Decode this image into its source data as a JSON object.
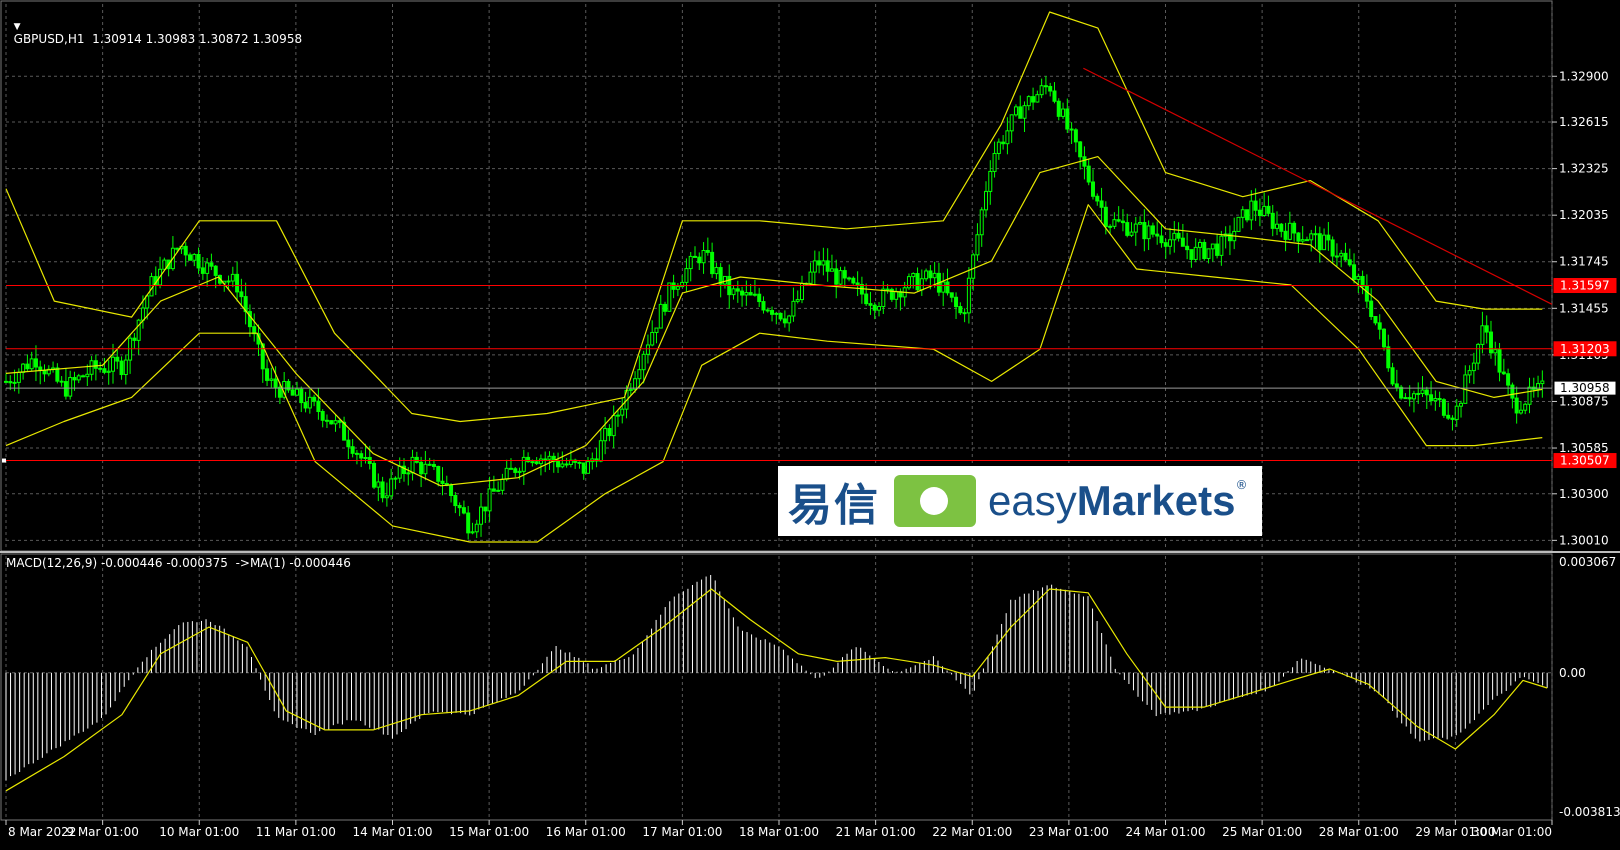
{
  "header": {
    "symbol_line": "GBPUSD,H1  1.30914 1.30983 1.30872 1.30958",
    "macd_line": "MACD(12,26,9) -0.000446 -0.000375  ->MA(1) -0.000446"
  },
  "watermark": {
    "chinese": "易信",
    "english_light": "easy",
    "english_bold": "Markets",
    "registered": "®"
  },
  "colors": {
    "background": "#000000",
    "grid": "#5a5a5a",
    "candle": "#00ff00",
    "bollinger": "#e8e800",
    "level_line": "#ff0000",
    "trend_line": "#d40000",
    "macd_hist": "#ffffff",
    "macd_signal": "#e8e800"
  },
  "chart_data": [
    {
      "type": "line",
      "title": "GBPUSD,H1",
      "x": [
        "8 Mar 2022",
        "9 Mar 01:00",
        "10 Mar 01:00",
        "11 Mar 01:00",
        "14 Mar 01:00",
        "15 Mar 01:00",
        "16 Mar 01:00",
        "17 Mar 01:00",
        "18 Mar 01:00",
        "21 Mar 01:00",
        "22 Mar 01:00",
        "23 Mar 01:00",
        "24 Mar 01:00",
        "25 Mar 01:00",
        "28 Mar 01:00",
        "29 Mar 01:00",
        "30 Mar 01:00"
      ],
      "y_ticks": [
        "1.32900",
        "1.32615",
        "1.32325",
        "1.32035",
        "1.31745",
        "1.31455",
        "1.31165",
        "1.30875",
        "1.30585",
        "1.30300",
        "1.30010"
      ],
      "ylim": [
        1.2995,
        1.3335
      ],
      "series": [],
      "price_path": [
        [
          0,
          1.31
        ],
        [
          0.3,
          1.3115
        ],
        [
          0.6,
          1.3095
        ],
        [
          0.9,
          1.3108
        ],
        [
          1.2,
          1.311
        ],
        [
          1.5,
          1.316
        ],
        [
          1.8,
          1.3185
        ],
        [
          2.1,
          1.317
        ],
        [
          2.4,
          1.316
        ],
        [
          2.7,
          1.31
        ],
        [
          3.0,
          1.309
        ],
        [
          3.3,
          1.308
        ],
        [
          3.6,
          1.306
        ],
        [
          3.9,
          1.303
        ],
        [
          4.2,
          1.305
        ],
        [
          4.5,
          1.304
        ],
        [
          4.8,
          1.301
        ],
        [
          5.1,
          1.3035
        ],
        [
          5.4,
          1.3055
        ],
        [
          5.7,
          1.305
        ],
        [
          6.0,
          1.3045
        ],
        [
          6.3,
          1.3075
        ],
        [
          6.6,
          1.312
        ],
        [
          6.9,
          1.316
        ],
        [
          7.2,
          1.318
        ],
        [
          7.5,
          1.3155
        ],
        [
          7.8,
          1.315
        ],
        [
          8.1,
          1.314
        ],
        [
          8.4,
          1.3175
        ],
        [
          8.7,
          1.316
        ],
        [
          9.0,
          1.315
        ],
        [
          9.3,
          1.316
        ],
        [
          9.6,
          1.3165
        ],
        [
          9.9,
          1.314
        ],
        [
          10.2,
          1.324
        ],
        [
          10.5,
          1.327
        ],
        [
          10.8,
          1.3285
        ],
        [
          11.1,
          1.324
        ],
        [
          11.4,
          1.32
        ],
        [
          11.7,
          1.3195
        ],
        [
          12.0,
          1.319
        ],
        [
          12.3,
          1.318
        ],
        [
          12.6,
          1.3185
        ],
        [
          12.9,
          1.321
        ],
        [
          13.2,
          1.3195
        ],
        [
          13.5,
          1.319
        ],
        [
          13.8,
          1.318
        ],
        [
          14.1,
          1.315
        ],
        [
          14.4,
          1.3095
        ],
        [
          14.7,
          1.309
        ],
        [
          15.0,
          1.308
        ],
        [
          15.3,
          1.3135
        ],
        [
          15.6,
          1.3085
        ],
        [
          15.9,
          1.3095
        ]
      ],
      "bollinger_mid": [
        [
          0,
          1.3105
        ],
        [
          1,
          1.311
        ],
        [
          1.6,
          1.315
        ],
        [
          2.2,
          1.3165
        ],
        [
          3.0,
          1.3105
        ],
        [
          3.8,
          1.3055
        ],
        [
          4.5,
          1.3035
        ],
        [
          5.3,
          1.304
        ],
        [
          6.0,
          1.306
        ],
        [
          6.6,
          1.31
        ],
        [
          7.0,
          1.3155
        ],
        [
          7.6,
          1.3165
        ],
        [
          8.4,
          1.316
        ],
        [
          9.4,
          1.3155
        ],
        [
          10.2,
          1.3175
        ],
        [
          10.7,
          1.323
        ],
        [
          11.3,
          1.324
        ],
        [
          12.0,
          1.3195
        ],
        [
          12.8,
          1.319
        ],
        [
          13.5,
          1.3185
        ],
        [
          14.2,
          1.315
        ],
        [
          14.8,
          1.31
        ],
        [
          15.4,
          1.309
        ],
        [
          15.9,
          1.3095
        ]
      ],
      "bollinger_upper": [
        [
          0,
          1.322
        ],
        [
          0.5,
          1.315
        ],
        [
          1.3,
          1.314
        ],
        [
          2.0,
          1.32
        ],
        [
          2.8,
          1.32
        ],
        [
          3.4,
          1.313
        ],
        [
          4.2,
          1.308
        ],
        [
          4.7,
          1.3075
        ],
        [
          5.6,
          1.308
        ],
        [
          6.4,
          1.309
        ],
        [
          7.0,
          1.32
        ],
        [
          7.8,
          1.32
        ],
        [
          8.7,
          1.3195
        ],
        [
          9.7,
          1.32
        ],
        [
          10.3,
          1.326
        ],
        [
          10.8,
          1.333
        ],
        [
          11.3,
          1.332
        ],
        [
          12.0,
          1.323
        ],
        [
          12.8,
          1.3215
        ],
        [
          13.5,
          1.3225
        ],
        [
          14.2,
          1.32
        ],
        [
          14.8,
          1.315
        ],
        [
          15.3,
          1.3145
        ],
        [
          15.9,
          1.3145
        ]
      ],
      "bollinger_lower": [
        [
          0,
          1.306
        ],
        [
          0.6,
          1.3075
        ],
        [
          1.3,
          1.309
        ],
        [
          2.0,
          1.313
        ],
        [
          2.6,
          1.313
        ],
        [
          3.2,
          1.305
        ],
        [
          4.0,
          1.301
        ],
        [
          4.8,
          1.3
        ],
        [
          5.5,
          1.3
        ],
        [
          6.2,
          1.303
        ],
        [
          6.8,
          1.305
        ],
        [
          7.2,
          1.311
        ],
        [
          7.8,
          1.313
        ],
        [
          8.5,
          1.3125
        ],
        [
          9.6,
          1.312
        ],
        [
          10.2,
          1.31
        ],
        [
          10.7,
          1.312
        ],
        [
          11.2,
          1.321
        ],
        [
          11.7,
          1.317
        ],
        [
          12.5,
          1.3165
        ],
        [
          13.3,
          1.316
        ],
        [
          14.0,
          1.312
        ],
        [
          14.7,
          1.306
        ],
        [
          15.2,
          1.306
        ],
        [
          15.9,
          1.3065
        ]
      ],
      "horizontal_levels": [
        {
          "value": 1.31597,
          "label": "1.31597",
          "style": "red"
        },
        {
          "value": 1.31203,
          "label": "1.31203",
          "style": "red"
        },
        {
          "value": 1.30958,
          "label": "1.30958",
          "style": "current"
        },
        {
          "value": 1.30507,
          "label": "1.30507",
          "style": "red"
        }
      ],
      "trend_line": [
        [
          11.15,
          1.3295
        ],
        [
          16.0,
          1.3148
        ]
      ]
    },
    {
      "type": "bar",
      "title": "MACD(12,26,9)",
      "y_ticks": [
        "0.003067",
        "0.00",
        "-0.003813"
      ],
      "ylim": [
        -0.003813,
        0.003067
      ],
      "macd_path": [
        [
          0,
          -0.0028
        ],
        [
          0.5,
          -0.002
        ],
        [
          1.0,
          -0.0012
        ],
        [
          1.4,
          0.0003
        ],
        [
          1.8,
          0.0013
        ],
        [
          2.1,
          0.0014
        ],
        [
          2.5,
          0.0007
        ],
        [
          2.8,
          -0.0012
        ],
        [
          3.2,
          -0.0016
        ],
        [
          3.6,
          -0.0012
        ],
        [
          4.0,
          -0.0017
        ],
        [
          4.4,
          -0.001
        ],
        [
          4.8,
          -0.0011
        ],
        [
          5.3,
          -0.0005
        ],
        [
          5.7,
          0.0007
        ],
        [
          6.1,
          0.0001
        ],
        [
          6.5,
          0.0005
        ],
        [
          6.9,
          0.002
        ],
        [
          7.3,
          0.0026
        ],
        [
          7.6,
          0.0011
        ],
        [
          8.0,
          0.0007
        ],
        [
          8.4,
          -0.0002
        ],
        [
          8.8,
          0.0007
        ],
        [
          9.2,
          0.0
        ],
        [
          9.6,
          0.0004
        ],
        [
          10.0,
          -0.0006
        ],
        [
          10.4,
          0.0019
        ],
        [
          10.8,
          0.0023
        ],
        [
          11.2,
          0.002
        ],
        [
          11.5,
          0.0
        ],
        [
          11.9,
          -0.0011
        ],
        [
          12.3,
          -0.001
        ],
        [
          12.7,
          -0.0007
        ],
        [
          13.1,
          -0.0004
        ],
        [
          13.4,
          0.0004
        ],
        [
          13.8,
          0.0
        ],
        [
          14.2,
          -0.0005
        ],
        [
          14.6,
          -0.0018
        ],
        [
          15.0,
          -0.0017
        ],
        [
          15.4,
          -0.0007
        ],
        [
          15.7,
          -0.0001
        ],
        [
          15.95,
          -0.0004
        ]
      ],
      "signal_path": [
        [
          0,
          -0.0031
        ],
        [
          0.6,
          -0.0022
        ],
        [
          1.2,
          -0.0011
        ],
        [
          1.6,
          0.0005
        ],
        [
          2.1,
          0.0012
        ],
        [
          2.5,
          0.0008
        ],
        [
          2.9,
          -0.001
        ],
        [
          3.3,
          -0.0015
        ],
        [
          3.8,
          -0.0015
        ],
        [
          4.3,
          -0.0011
        ],
        [
          4.8,
          -0.001
        ],
        [
          5.3,
          -0.0006
        ],
        [
          5.8,
          0.0003
        ],
        [
          6.3,
          0.0003
        ],
        [
          6.8,
          0.0012
        ],
        [
          7.3,
          0.0022
        ],
        [
          7.7,
          0.0014
        ],
        [
          8.2,
          0.0005
        ],
        [
          8.6,
          0.0003
        ],
        [
          9.1,
          0.0004
        ],
        [
          9.6,
          0.0002
        ],
        [
          10.0,
          -0.0001
        ],
        [
          10.4,
          0.0012
        ],
        [
          10.8,
          0.0022
        ],
        [
          11.2,
          0.0021
        ],
        [
          11.6,
          0.0005
        ],
        [
          12.0,
          -0.0009
        ],
        [
          12.4,
          -0.0009
        ],
        [
          12.8,
          -0.0006
        ],
        [
          13.3,
          -0.0002
        ],
        [
          13.7,
          0.0001
        ],
        [
          14.1,
          -0.0003
        ],
        [
          14.6,
          -0.0014
        ],
        [
          15.0,
          -0.002
        ],
        [
          15.4,
          -0.0011
        ],
        [
          15.7,
          -0.0002
        ],
        [
          15.95,
          -0.0004
        ]
      ]
    }
  ]
}
